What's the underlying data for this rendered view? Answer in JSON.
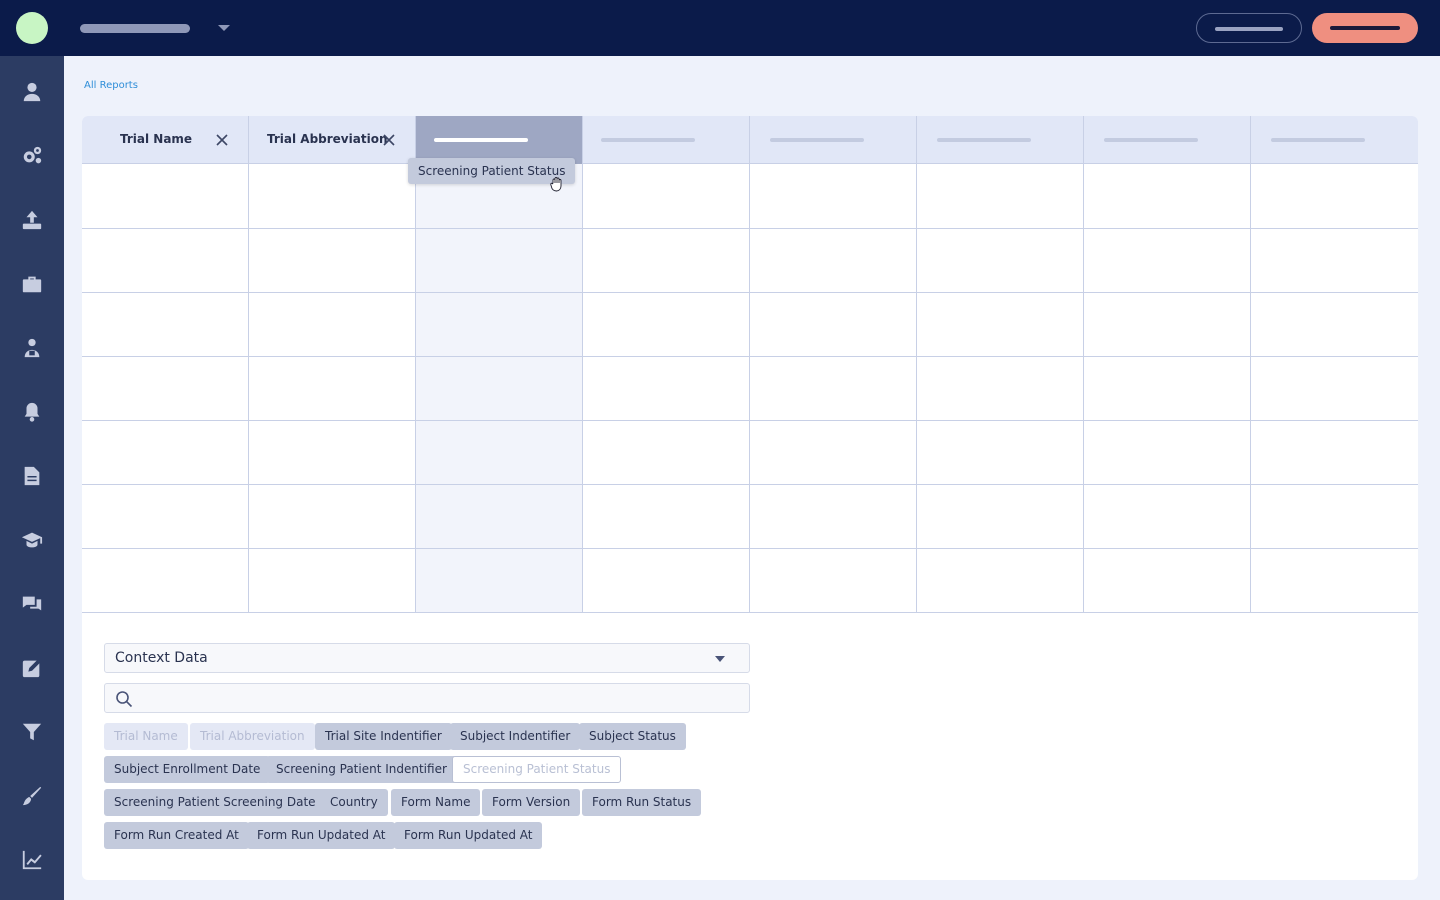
{
  "breadcrumb": {
    "label": "All Reports"
  },
  "table": {
    "columns": [
      {
        "label": "Trial Name",
        "removable": true
      },
      {
        "label": "Trial Abbreviation",
        "removable": true
      }
    ]
  },
  "drag_chip": {
    "label": "Screening Patient Status"
  },
  "context": {
    "select_value": "Context Data",
    "search_placeholder": "",
    "fields": [
      {
        "label": "Trial Name",
        "state": "used"
      },
      {
        "label": "Trial Abbreviation",
        "state": "used"
      },
      {
        "label": "Trial Site Indentifier",
        "state": "available"
      },
      {
        "label": "Subject Indentifier",
        "state": "available"
      },
      {
        "label": "Subject Status",
        "state": "available"
      },
      {
        "label": "Subject Enrollment Date",
        "state": "available"
      },
      {
        "label": "Screening Patient Indentifier",
        "state": "available"
      },
      {
        "label": "Screening Patient Status",
        "state": "dragging"
      },
      {
        "label": "Screening Patient Screening Date",
        "state": "available"
      },
      {
        "label": "Country",
        "state": "available"
      },
      {
        "label": "Form Name",
        "state": "available"
      },
      {
        "label": "Form Version",
        "state": "available"
      },
      {
        "label": "Form Run Status",
        "state": "available"
      },
      {
        "label": "Form Run Created At",
        "state": "available"
      },
      {
        "label": "Form Run Updated At",
        "state": "available"
      },
      {
        "label": "Form Run Updated At",
        "state": "available"
      }
    ]
  },
  "sidebar": {
    "icons": [
      "user-icon",
      "settings-icon",
      "upload-icon",
      "briefcase-icon",
      "users-icon",
      "bell-icon",
      "document-icon",
      "graduation-icon",
      "chat-icon",
      "edit-icon",
      "filter-icon",
      "brush-icon",
      "chart-icon"
    ]
  }
}
